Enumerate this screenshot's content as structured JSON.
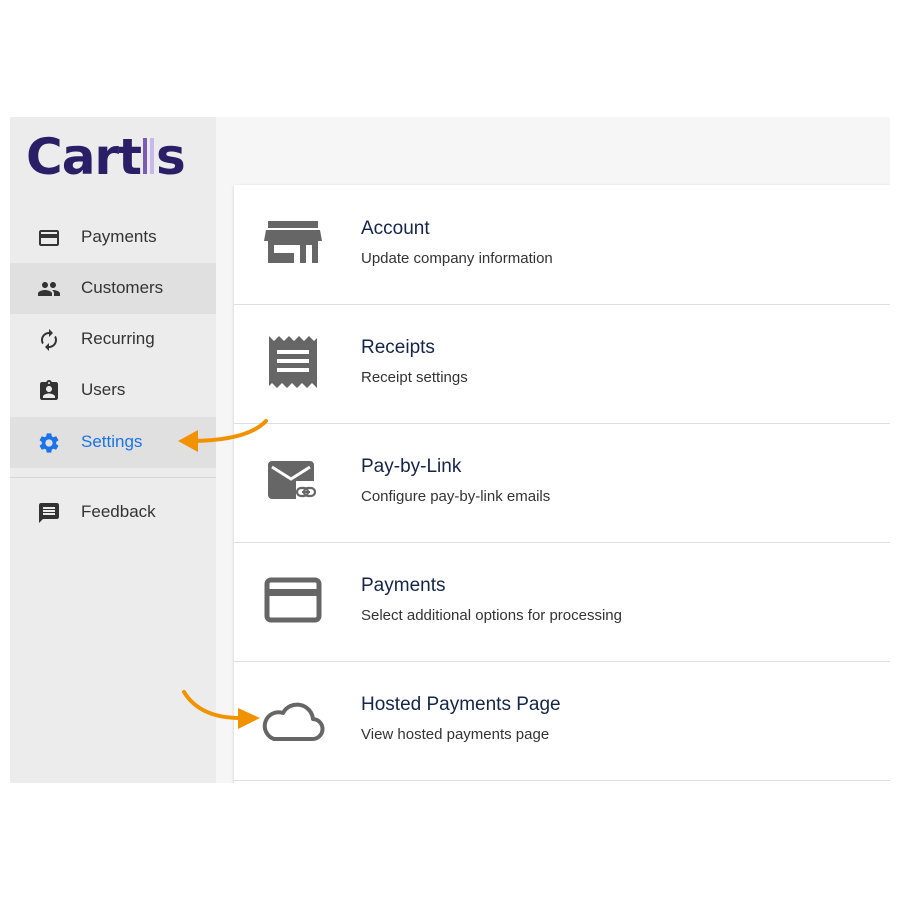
{
  "brand": {
    "logo_prefix": "Cart",
    "logo_suffix": "s",
    "logo_color": "#2a1f66",
    "bar_colors": [
      "#7a5ab5",
      "#c9b8ea"
    ]
  },
  "sidebar": {
    "items": [
      {
        "label": "Payments",
        "icon": "credit-card-icon",
        "state": "normal"
      },
      {
        "label": "Customers",
        "icon": "people-icon",
        "state": "hover"
      },
      {
        "label": "Recurring",
        "icon": "refresh-icon",
        "state": "normal"
      },
      {
        "label": "Users",
        "icon": "badge-icon",
        "state": "normal"
      },
      {
        "label": "Settings",
        "icon": "gear-icon",
        "state": "active"
      },
      {
        "label": "Feedback",
        "icon": "feedback-icon",
        "state": "normal"
      }
    ],
    "active_color": "#1a73e8"
  },
  "settings": {
    "rows": [
      {
        "title": "Account",
        "subtitle": "Update company information",
        "icon": "storefront-icon"
      },
      {
        "title": "Receipts",
        "subtitle": "Receipt settings",
        "icon": "receipt-icon"
      },
      {
        "title": "Pay-by-Link",
        "subtitle": "Configure pay-by-link emails",
        "icon": "mail-link-icon"
      },
      {
        "title": "Payments",
        "subtitle": "Select additional options for processing",
        "icon": "credit-card-icon"
      },
      {
        "title": "Hosted Payments Page",
        "subtitle": "View hosted payments page",
        "icon": "cloud-icon"
      }
    ]
  },
  "annotations": {
    "arrow_color": "#f39200",
    "arrow_targets": [
      "Settings",
      "Hosted Payments Page"
    ]
  }
}
